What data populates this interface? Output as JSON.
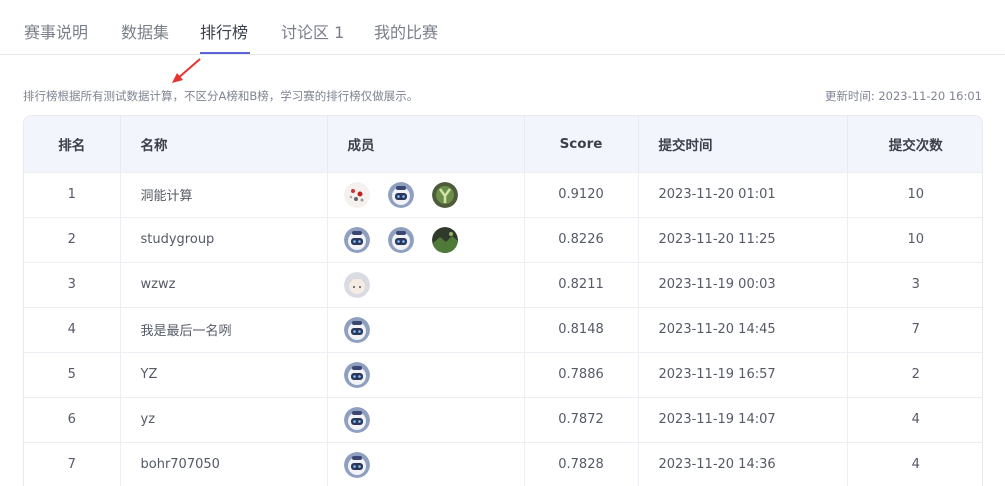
{
  "tabs": [
    {
      "label": "赛事说明",
      "active": false
    },
    {
      "label": "数据集",
      "active": false
    },
    {
      "label": "排行榜",
      "active": true
    },
    {
      "label": "讨论区 1",
      "active": false
    },
    {
      "label": "我的比赛",
      "active": false
    }
  ],
  "notice": "排行榜根据所有测试数据计算，不区分A榜和B榜，学习赛的排行榜仅做展示。",
  "updated": "更新时间: 2023-11-20 16:01",
  "colors": {
    "accent": "#5b67d6",
    "header_bg": "#f3f5fc",
    "arrow": "#e8322e"
  },
  "table": {
    "headers": {
      "rank": "排名",
      "name": "名称",
      "members": "成员",
      "score": "Score",
      "time": "提交时间",
      "count": "提交次数"
    },
    "rows": [
      {
        "rank": "1",
        "name": "洞能计算",
        "members": [
          "doodle-avatar",
          "robot-avatar",
          "green-y-avatar"
        ],
        "score": "0.9120",
        "time": "2023-11-20 01:01",
        "count": "10"
      },
      {
        "rank": "2",
        "name": "studygroup",
        "members": [
          "robot-avatar",
          "robot-avatar",
          "landscape-avatar"
        ],
        "score": "0.8226",
        "time": "2023-11-20 11:25",
        "count": "10"
      },
      {
        "rank": "3",
        "name": "wzwz",
        "members": [
          "anime-avatar"
        ],
        "score": "0.8211",
        "time": "2023-11-19 00:03",
        "count": "3"
      },
      {
        "rank": "4",
        "name": "我是最后一名咧",
        "members": [
          "robot-avatar"
        ],
        "score": "0.8148",
        "time": "2023-11-20 14:45",
        "count": "7"
      },
      {
        "rank": "5",
        "name": "YZ",
        "members": [
          "robot-avatar"
        ],
        "score": "0.7886",
        "time": "2023-11-19 16:57",
        "count": "2"
      },
      {
        "rank": "6",
        "name": "yz",
        "members": [
          "robot-avatar"
        ],
        "score": "0.7872",
        "time": "2023-11-19 14:07",
        "count": "4"
      },
      {
        "rank": "7",
        "name": "bohr707050",
        "members": [
          "robot-avatar"
        ],
        "score": "0.7828",
        "time": "2023-11-20 14:36",
        "count": "4"
      }
    ]
  }
}
